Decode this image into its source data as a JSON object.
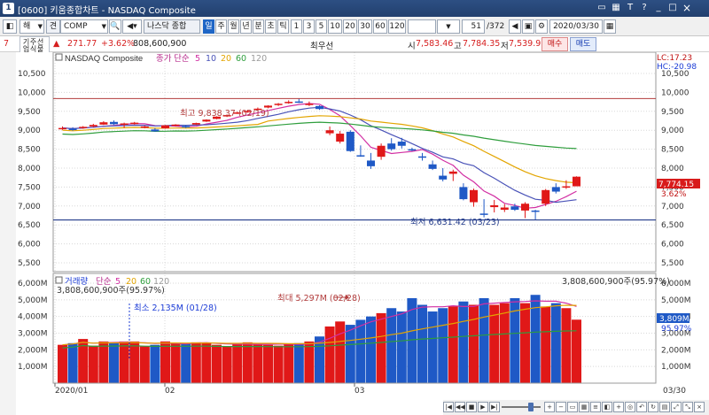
{
  "window": {
    "number": "1",
    "title": "[0600] 키움종합차트 - NASDAQ Composite"
  },
  "toolbar": {
    "market_select": "해",
    "type_label": "견",
    "symbol": "COMP",
    "index_name": "나스닥 종합",
    "periods": [
      "일",
      "주",
      "월",
      "년",
      "분",
      "초",
      "틱"
    ],
    "selected_period": "일",
    "intervals": [
      "1",
      "3",
      "5",
      "10",
      "20",
      "30",
      "60",
      "120"
    ],
    "count_value": "51",
    "count_total": "/372",
    "date": "2020/03/30"
  },
  "quote": {
    "left_value": "7",
    "change": "271.77",
    "change_pct": "+3.62%",
    "volume": "808,600,900",
    "label": "최우선",
    "open_label": "시",
    "open": "7,583.46",
    "high_label": "고",
    "high": "7,784.35",
    "low_label": "저",
    "low": "7,539.97",
    "buy": "매수",
    "sell": "매도"
  },
  "left_tabs": [
    "기업",
    "주식",
    "선물",
    "해외"
  ],
  "price_panel": {
    "legend_name": "NASDAQ Composite",
    "ma_label": "종가 단순",
    "ma_periods": [
      "5",
      "10",
      "20",
      "60",
      "120"
    ],
    "ma_colors": [
      "#d22fa3",
      "#4a53b8",
      "#e3a500",
      "#2f9e3d",
      "#9a9a9a"
    ],
    "high_note": "최고 9,838.37 (02/19)",
    "low_note": "최저 6,631.42 (03/23)",
    "last_price": "7,774.15",
    "last_pct": "3.62%",
    "lc": "LC:17.23",
    "hc": "HC:-20.98",
    "y_ticks": [
      "10,500",
      "10,000",
      "9,500",
      "9,000",
      "8,500",
      "8,000",
      "7,500",
      "7,000",
      "6,500",
      "6,000",
      "5,500"
    ]
  },
  "volume_panel": {
    "legend_name": "거래량",
    "ma_label": "단순",
    "ma_periods": [
      "5",
      "20",
      "60",
      "120"
    ],
    "ma_colors": [
      "#d22fa3",
      "#e3a500",
      "#2f9e3d",
      "#9a9a9a"
    ],
    "left_note": "3,808,600,900주(95.97%)",
    "right_note": "3,808,600,900주(95.97%)",
    "min_note": "최소 2,135M (01/28)",
    "max_note": "최대 5,297M (02/28)",
    "last_value": "3,809M",
    "last_pct": "95.97%",
    "y_ticks": [
      "6,000M",
      "5,000M",
      "4,000M",
      "3,000M",
      "2,000M",
      "1,000M"
    ]
  },
  "x_axis": {
    "labels": [
      "2020/01",
      "02",
      "03"
    ],
    "right_label": "03/30"
  },
  "chart_data": {
    "type": "candlestick",
    "title": "NASDAQ Composite",
    "ylim": [
      5300,
      10700
    ],
    "volume_ylim": [
      0,
      6200
    ],
    "ohlc": [
      [
        9050,
        9100,
        9010,
        9060
      ],
      [
        9040,
        9080,
        8990,
        9030
      ],
      [
        9070,
        9110,
        9040,
        9090
      ],
      [
        9100,
        9170,
        9080,
        9140
      ],
      [
        9150,
        9240,
        9140,
        9210
      ],
      [
        9220,
        9260,
        9140,
        9160
      ],
      [
        9150,
        9200,
        9060,
        9180
      ],
      [
        9180,
        9220,
        9150,
        9200
      ],
      [
        9080,
        9120,
        9050,
        9100
      ],
      [
        9020,
        9060,
        8960,
        8970
      ],
      [
        9050,
        9140,
        9040,
        9130
      ],
      [
        9120,
        9160,
        9100,
        9150
      ],
      [
        9110,
        9140,
        9060,
        9080
      ],
      [
        9150,
        9200,
        9140,
        9190
      ],
      [
        9230,
        9290,
        9220,
        9280
      ],
      [
        9300,
        9370,
        9290,
        9360
      ],
      [
        9390,
        9420,
        9350,
        9400
      ],
      [
        9450,
        9490,
        9430,
        9470
      ],
      [
        9500,
        9540,
        9460,
        9510
      ],
      [
        9550,
        9600,
        9530,
        9570
      ],
      [
        9600,
        9660,
        9580,
        9650
      ],
      [
        9670,
        9720,
        9640,
        9700
      ],
      [
        9720,
        9790,
        9700,
        9750
      ],
      [
        9760,
        9838,
        9720,
        9730
      ],
      [
        9700,
        9760,
        9640,
        9700
      ],
      [
        9640,
        9660,
        9540,
        9560
      ],
      [
        8920,
        9100,
        8870,
        9000
      ],
      [
        8700,
        8980,
        8650,
        8910
      ],
      [
        8960,
        9000,
        8430,
        8450
      ],
      [
        8320,
        8600,
        8300,
        8340
      ],
      [
        8200,
        8400,
        7980,
        8050
      ],
      [
        8300,
        8650,
        8220,
        8590
      ],
      [
        8650,
        8790,
        8460,
        8500
      ],
      [
        8700,
        8800,
        8520,
        8590
      ],
      [
        8500,
        8540,
        8450,
        8480
      ],
      [
        8310,
        8400,
        8200,
        8290
      ],
      [
        8100,
        8200,
        7950,
        7980
      ],
      [
        7800,
        8000,
        7650,
        7700
      ],
      [
        7850,
        7960,
        7660,
        7910
      ],
      [
        7500,
        7600,
        7150,
        7180
      ],
      [
        7100,
        7460,
        6980,
        7420
      ],
      [
        6800,
        7180,
        6700,
        6770
      ],
      [
        6970,
        7160,
        6830,
        7020
      ],
      [
        6900,
        7050,
        6840,
        6960
      ],
      [
        6990,
        7060,
        6870,
        6900
      ],
      [
        6880,
        7100,
        6680,
        7060
      ],
      [
        6880,
        6900,
        6631,
        6860
      ],
      [
        7060,
        7450,
        7000,
        7420
      ],
      [
        7500,
        7600,
        7330,
        7380
      ],
      [
        7500,
        7680,
        7450,
        7520
      ],
      [
        7520,
        7784,
        7540,
        7774
      ]
    ],
    "volume": [
      2300,
      2400,
      2650,
      2250,
      2500,
      2400,
      2500,
      2500,
      2200,
      2300,
      2500,
      2400,
      2400,
      2450,
      2400,
      2300,
      2200,
      2350,
      2450,
      2350,
      2300,
      2250,
      2350,
      2400,
      2500,
      2800,
      3400,
      3700,
      3500,
      3800,
      4000,
      4200,
      4500,
      4300,
      5100,
      4700,
      4300,
      4500,
      4600,
      4900,
      4700,
      5100,
      4700,
      4800,
      5100,
      4800,
      5297,
      4600,
      4800,
      4500,
      3809
    ],
    "up": [
      true,
      false,
      true,
      true,
      true,
      false,
      true,
      true,
      true,
      false,
      true,
      true,
      false,
      true,
      true,
      true,
      true,
      true,
      true,
      true,
      true,
      true,
      true,
      false,
      true,
      false,
      true,
      true,
      false,
      false,
      false,
      true,
      false,
      false,
      false,
      false,
      false,
      false,
      true,
      false,
      true,
      false,
      true,
      true,
      false,
      true,
      false,
      true,
      false,
      true,
      true
    ]
  }
}
